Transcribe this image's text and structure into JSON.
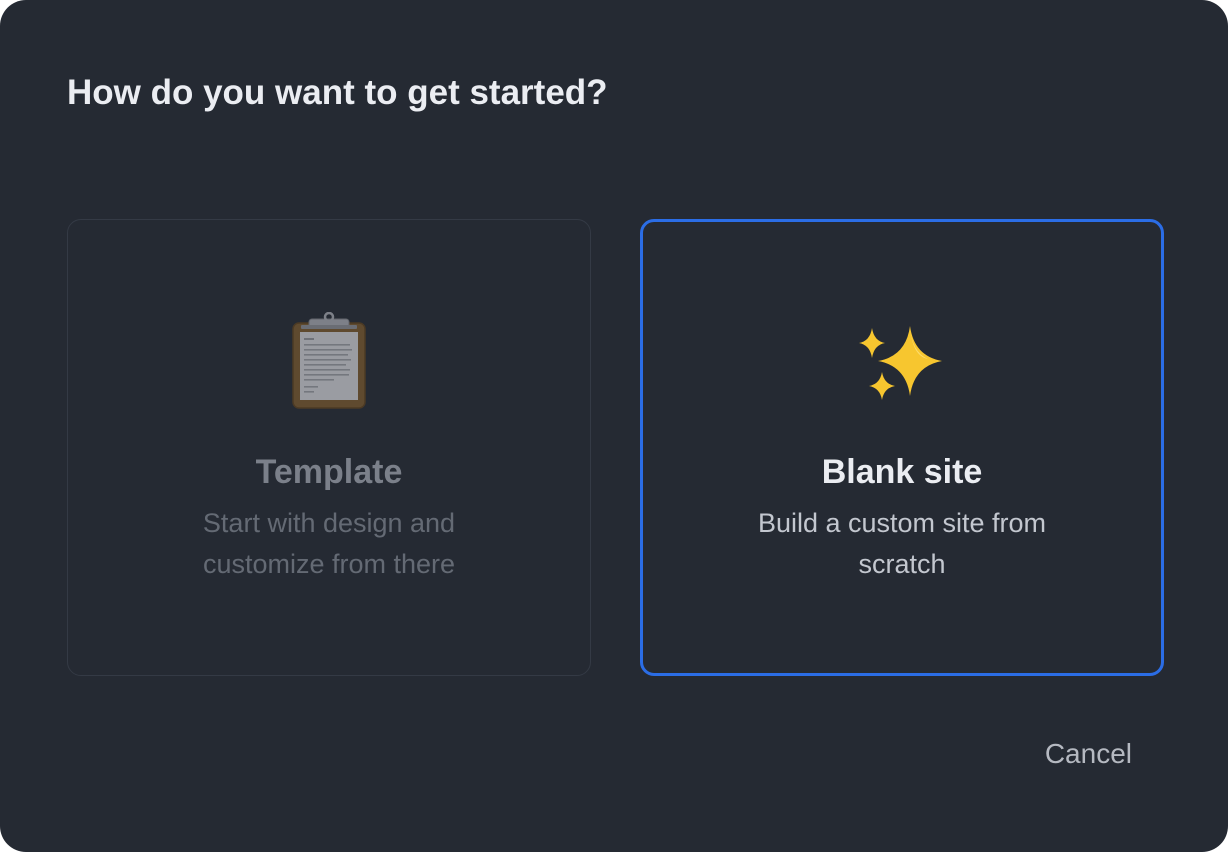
{
  "dialog": {
    "title": "How do you want to get started?"
  },
  "options": [
    {
      "icon": "clipboard-icon",
      "title": "Template",
      "description": "Start with design and customize from there",
      "state": "disabled"
    },
    {
      "icon": "sparkles-icon",
      "title": "Blank site",
      "description": "Build a custom site from scratch",
      "state": "selected"
    }
  ],
  "actions": {
    "cancel_label": "Cancel"
  },
  "colors": {
    "background": "#252a33",
    "selected_border": "#2b6de6",
    "title_text": "#ebedf2",
    "disabled_text": "#7b808a",
    "sparkle": "#f7c62f"
  }
}
